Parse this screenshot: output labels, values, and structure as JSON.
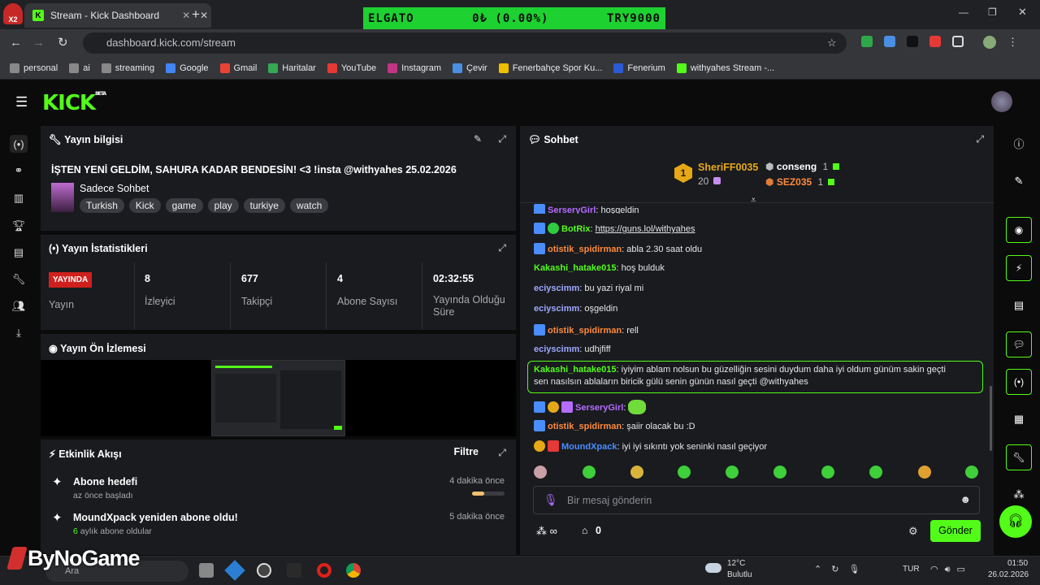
{
  "browser": {
    "tab_title": "Stream - Kick Dashboard",
    "url": "dashboard.kick.com/stream"
  },
  "ticker": {
    "left": "ELGATO",
    "mid": "0₺ (0.00%)",
    "right": "TRY9000"
  },
  "bookmarks": [
    "personal",
    "ai",
    "streaming",
    "Google",
    "Gmail",
    "Haritalar",
    "YouTube",
    "Instagram",
    "Çevir",
    "Fenerbahçe Spor Ku...",
    "Fenerium",
    "withyahes Stream -..."
  ],
  "header": {
    "logo": "KICK",
    "beta": "BETA"
  },
  "info_panel": {
    "title": "Yayın bilgisi",
    "stream_title": "İŞTEN YENİ GELDİM, SAHURA KADAR BENDESİN! <3 !insta @withyahes 25.02.2026",
    "category": "Sadece Sohbet",
    "tags": [
      "Turkish",
      "Kick",
      "game",
      "play",
      "turkiye",
      "watch"
    ]
  },
  "stats_panel": {
    "title": "Yayın İstatistikleri",
    "live_badge": "YAYINDA",
    "live_label": "Yayın",
    "stats": [
      {
        "value": "8",
        "label": "İzleyici"
      },
      {
        "value": "677",
        "label": "Takipçi"
      },
      {
        "value": "4",
        "label": "Abone Sayısı"
      },
      {
        "value": "02:32:55",
        "label": "Yayında Olduğu Süre"
      }
    ]
  },
  "preview_panel": {
    "title": "Yayın Ön İzlemesi"
  },
  "activity_panel": {
    "title": "Etkinlik Akışı",
    "filter": "Filtre",
    "items": [
      {
        "title": "Abone hedefi",
        "sub": "az önce başladı",
        "time": "4 dakika önce"
      },
      {
        "title": "MoundXpack yeniden abone oldu!",
        "sub_highlight": "6",
        "sub": " aylık abone oldular",
        "time": "5 dakika önce"
      }
    ]
  },
  "chat": {
    "title": "Sohbet",
    "leader": {
      "name": "SheriFF0035",
      "count": "20",
      "rank": "1"
    },
    "others": [
      {
        "name": "conseng",
        "count": "1"
      },
      {
        "name": "SEZ035",
        "count": "1"
      }
    ],
    "messages": [
      {
        "user": "SerseryGirl",
        "text": "hoşgeldin",
        "color": "#b56cff"
      },
      {
        "user": "BotRix",
        "text": "https://guns.lol/withyahes",
        "color": "#53fc18"
      },
      {
        "user": "otistik_spidirman",
        "text": "abla 2.30 saat oldu",
        "color": "#ff8a3d"
      },
      {
        "user": "Kakashi_hatake015",
        "text": "hoş bulduk",
        "color": "#53fc18"
      },
      {
        "user": "eciyscimm",
        "text": "bu yazi riyal mi",
        "color": "#9fa8ff"
      },
      {
        "user": "eciyscimm",
        "text": "oşgeldin",
        "color": "#9fa8ff"
      },
      {
        "user": "otistik_spidirman",
        "text": "rell",
        "color": "#ff8a3d"
      },
      {
        "user": "eciyscimm",
        "text": "udhjfiff",
        "color": "#9fa8ff"
      },
      {
        "user": "Kakashi_hatake015",
        "text": "iyiyim ablam nolsun bu güzelliğin sesini duydum daha iyi oldum günüm sakin geçti",
        "text2": "sen nasılsın ablaların biricik gülü senin günün nasıl geçti @withyahes",
        "color": "#53fc18"
      },
      {
        "user": "SerseryGirl",
        "text": "",
        "color": "#b56cff"
      },
      {
        "user": "otistik_spidirman",
        "text": "şaiir olacak bu :D",
        "color": "#ff8a3d"
      },
      {
        "user": "MoundXpack",
        "text": "iyi iyi sıkıntı yok seninki nasıl geçiyor",
        "color": "#4a8dff"
      }
    ],
    "input_placeholder": "Bir mesaj gönderin",
    "points": "∞",
    "store_count": "0",
    "send": "Gönder"
  },
  "taskbar": {
    "watermark": "ByNoGame",
    "search": "Ara",
    "weather_temp": "12°C",
    "weather_text": "Bulutlu",
    "lang": "TUR",
    "time": "01:50",
    "date": "26.02.2026"
  }
}
